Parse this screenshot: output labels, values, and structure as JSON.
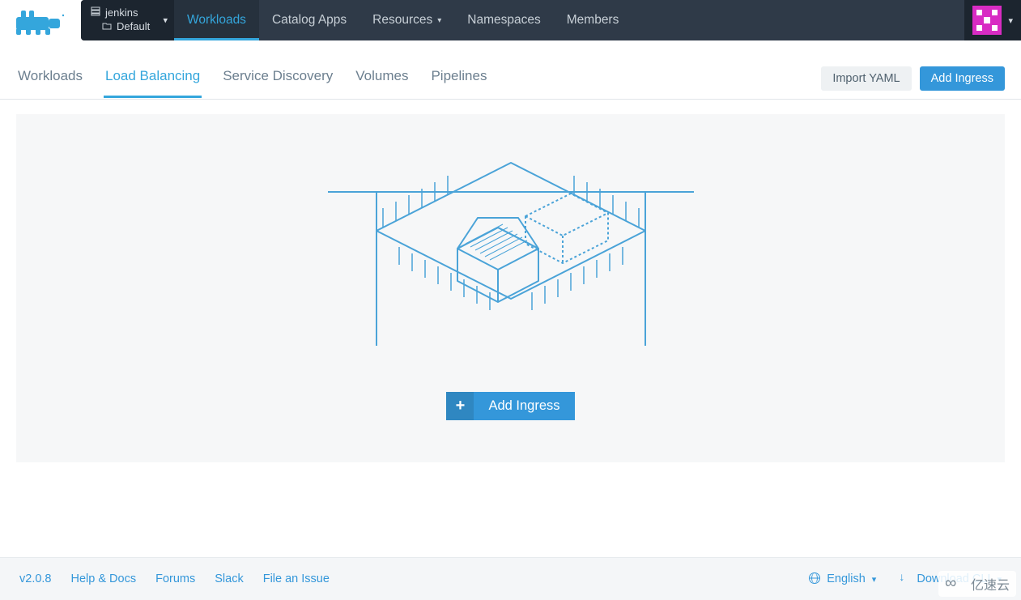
{
  "header": {
    "cluster_name": "jenkins",
    "project_name": "Default",
    "nav": [
      {
        "key": "workloads",
        "label": "Workloads",
        "active": true
      },
      {
        "key": "catalog",
        "label": "Catalog Apps",
        "active": false
      },
      {
        "key": "resources",
        "label": "Resources",
        "active": false,
        "dropdown": true
      },
      {
        "key": "namespaces",
        "label": "Namespaces",
        "active": false
      },
      {
        "key": "members",
        "label": "Members",
        "active": false
      }
    ]
  },
  "subnav": {
    "tabs": [
      {
        "key": "workloads",
        "label": "Workloads",
        "active": false
      },
      {
        "key": "load-balancing",
        "label": "Load Balancing",
        "active": true
      },
      {
        "key": "service-discovery",
        "label": "Service Discovery",
        "active": false
      },
      {
        "key": "volumes",
        "label": "Volumes",
        "active": false
      },
      {
        "key": "pipelines",
        "label": "Pipelines",
        "active": false
      }
    ],
    "import_yaml_label": "Import YAML",
    "add_ingress_label": "Add Ingress"
  },
  "empty_state": {
    "add_ingress_label": "Add Ingress"
  },
  "footer": {
    "version": "v2.0.8",
    "links": [
      {
        "key": "help",
        "label": "Help & Docs"
      },
      {
        "key": "forums",
        "label": "Forums"
      },
      {
        "key": "slack",
        "label": "Slack"
      },
      {
        "key": "issue",
        "label": "File an Issue"
      }
    ],
    "language_label": "English",
    "download_cli_label": "Download CLI"
  },
  "watermark": {
    "text": "亿速云"
  }
}
